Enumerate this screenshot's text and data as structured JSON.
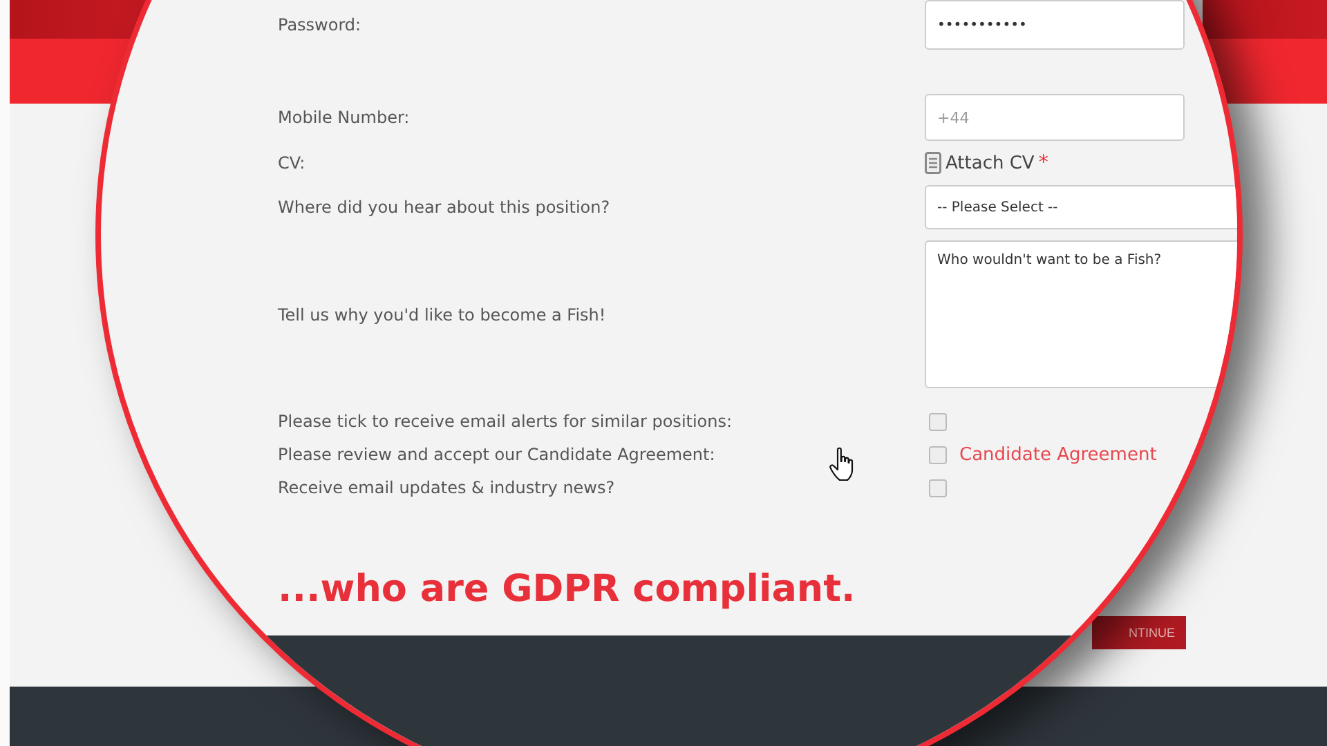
{
  "page": {
    "continue_button": "NTINUE"
  },
  "form": {
    "fields": [
      {
        "kind": "input",
        "label": "Password:",
        "value": "•••••••••••"
      },
      {
        "kind": "phone",
        "label": "Mobile Number:",
        "placeholder": "+44"
      },
      {
        "kind": "file",
        "label": "CV:",
        "link": "Attach CV",
        "required_mark": "*"
      },
      {
        "kind": "select",
        "label": "Where did you hear about this position?",
        "value": "-- Please Select --"
      },
      {
        "kind": "textarea",
        "label": "Tell us why you'd like to become a Fish!",
        "value": "Who wouldn't want to be a Fish?"
      },
      {
        "kind": "checkbox",
        "label": "Please tick to receive email alerts for similar positions:",
        "checked": false
      },
      {
        "kind": "checkbox",
        "label": "Please review and accept our Candidate Agreement:",
        "checked": false,
        "link": "Candidate Agreement"
      },
      {
        "kind": "checkbox",
        "label": "Receive email updates & industry news?",
        "checked": false
      }
    ]
  },
  "caption": "...who are GDPR compliant."
}
